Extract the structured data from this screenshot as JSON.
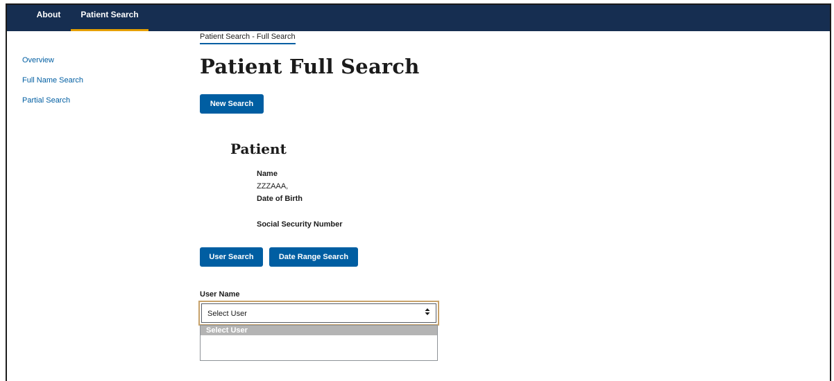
{
  "nav": {
    "items": [
      {
        "label": "About",
        "active": false
      },
      {
        "label": "Patient Search",
        "active": true
      }
    ],
    "active_underline_color": "#e5a000",
    "background": "#162e51"
  },
  "breadcrumb": "Patient Search - Full Search",
  "sidebar": {
    "items": [
      {
        "label": "Overview"
      },
      {
        "label": "Full Name Search"
      },
      {
        "label": "Partial Search"
      }
    ]
  },
  "main": {
    "title": "Patient Full Search",
    "new_search_label": "New Search",
    "patient": {
      "heading": "Patient",
      "name_label": "Name",
      "name_value": "ZZZAAA,",
      "dob_label": "Date of Birth",
      "dob_value": "",
      "ssn_label": "Social Security Number",
      "ssn_value": ""
    },
    "user_search_label": "User Search",
    "date_range_search_label": "Date Range Search",
    "user_name": {
      "label": "User Name",
      "selected": "Select User",
      "options": [
        "Select User"
      ]
    }
  },
  "colors": {
    "primary_button": "#005ea2",
    "link": "#005ea2",
    "focus_outline": "#c7a26a"
  }
}
